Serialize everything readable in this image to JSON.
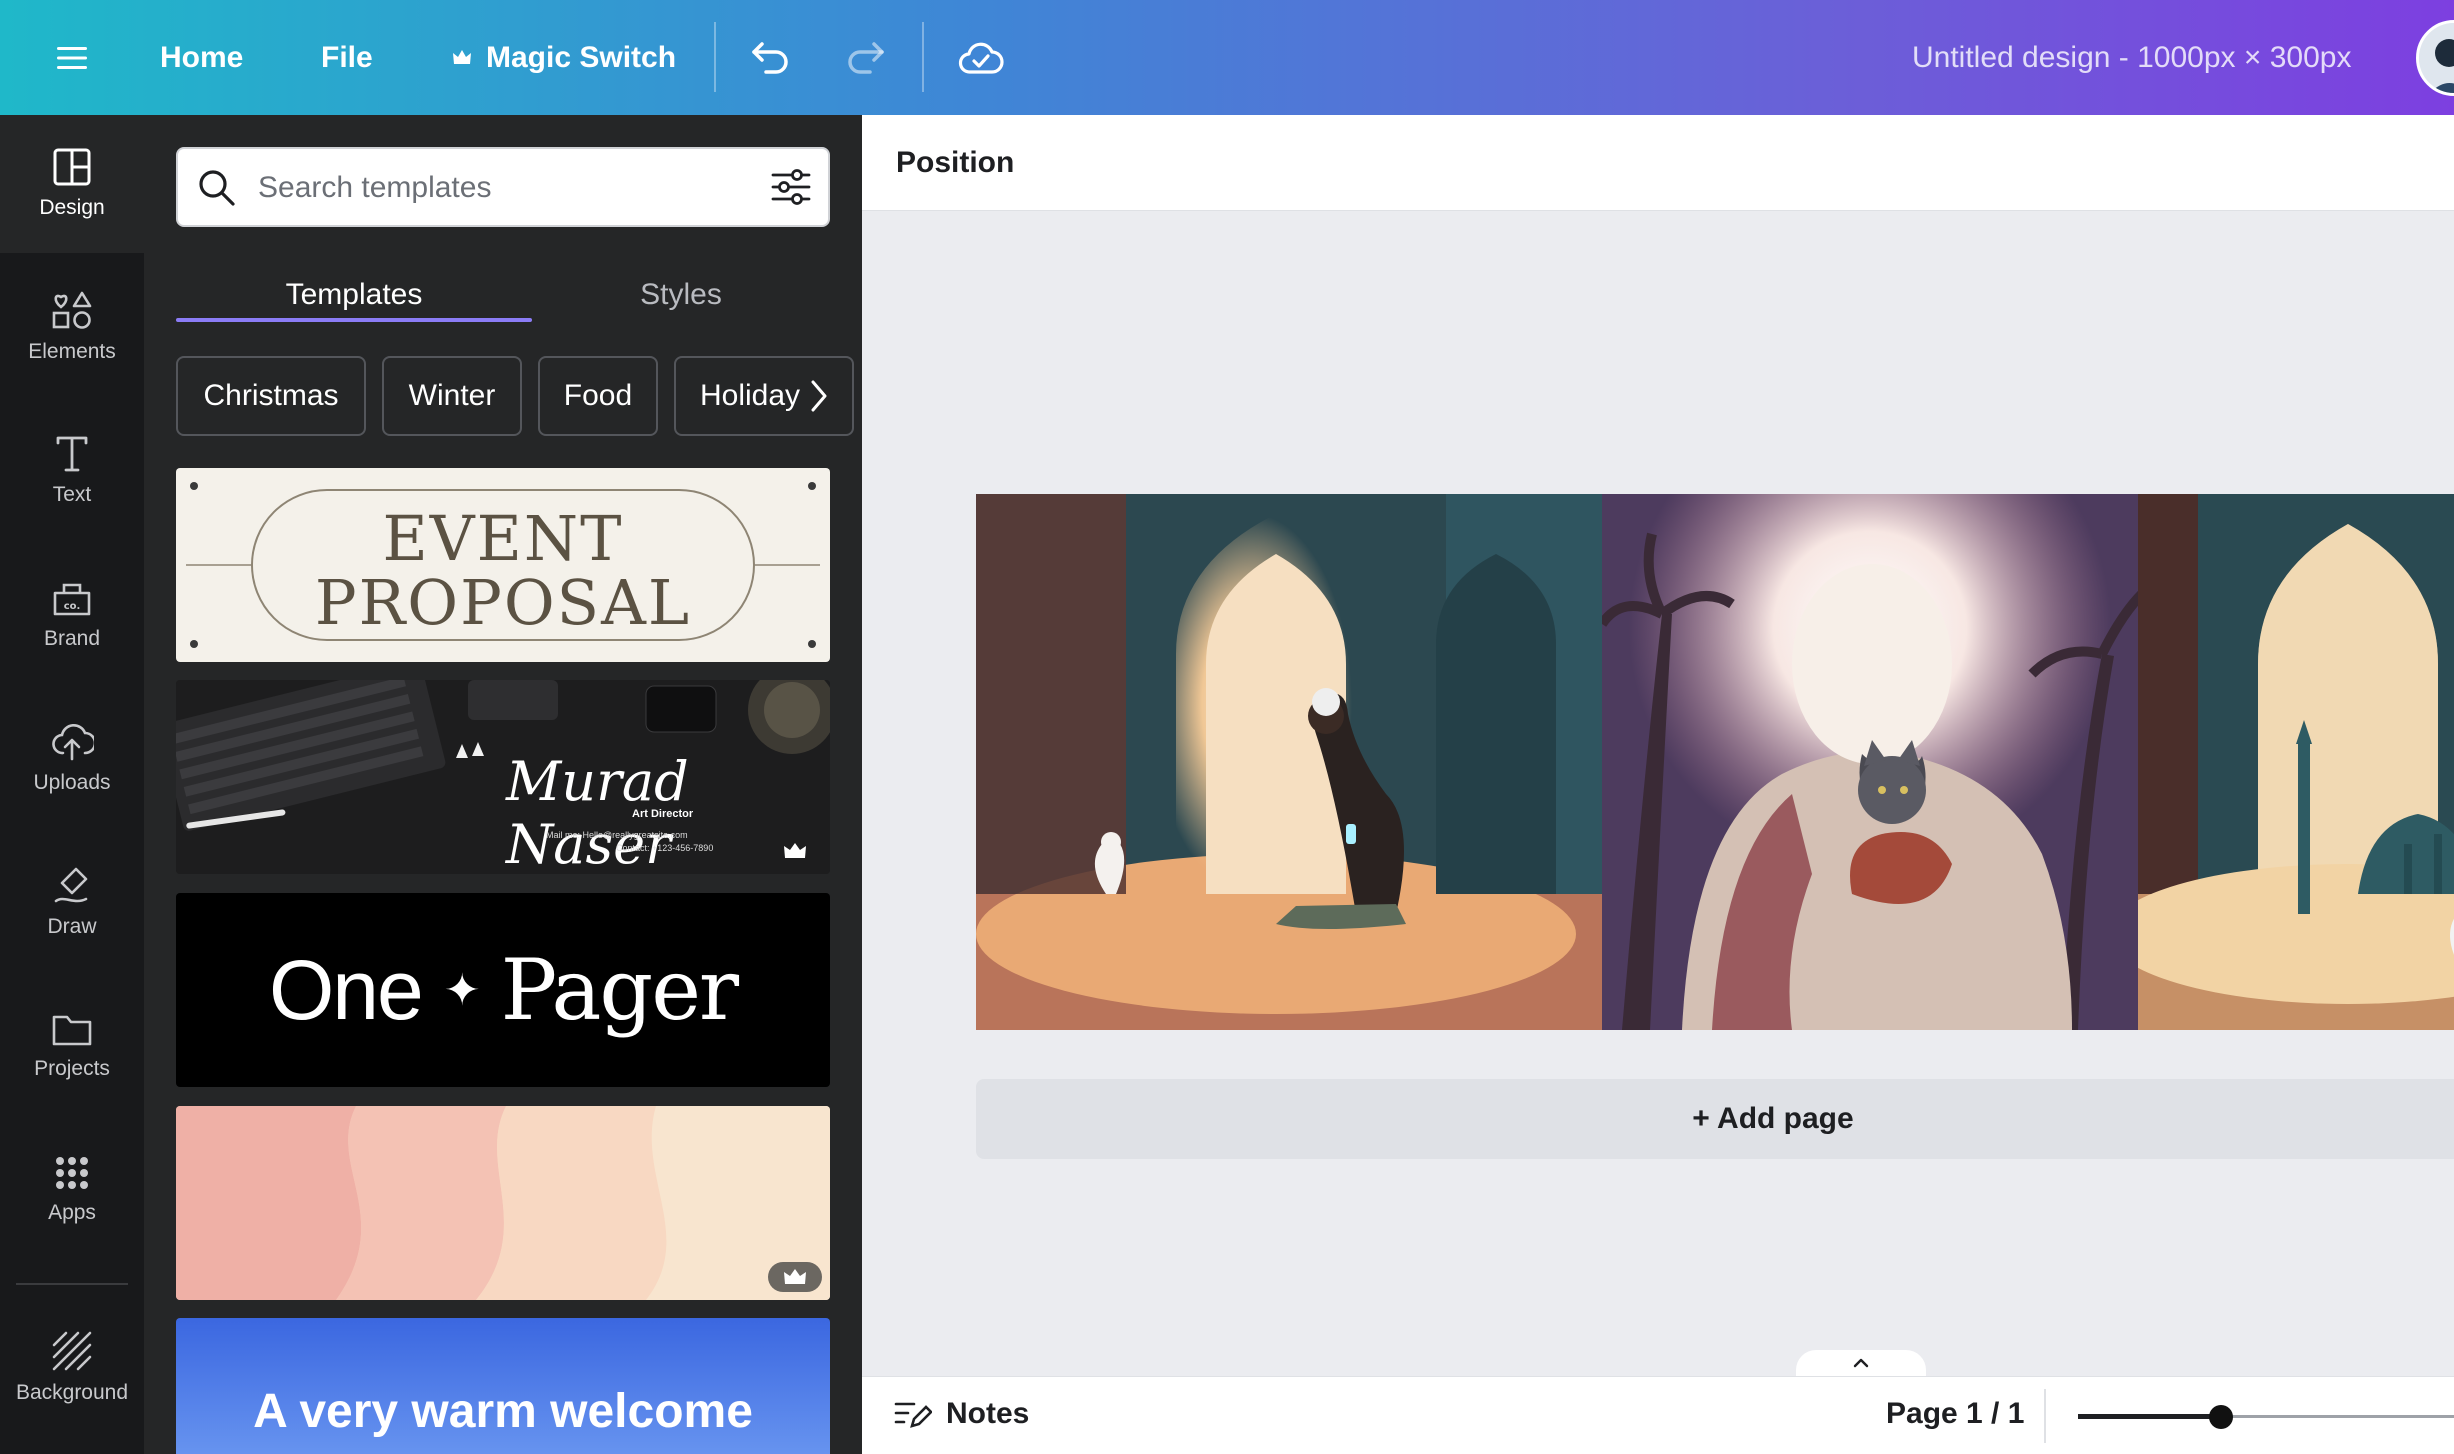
{
  "topbar": {
    "menu_icon": "hamburger-icon",
    "home": "Home",
    "file": "File",
    "magic_switch": "Magic Switch",
    "magic_icon": "crown-icon",
    "undo_icon": "undo-icon",
    "redo_icon": "redo-icon",
    "sync_icon": "cloud-check-icon",
    "doc_title": "Untitled design - 1000px × 300px"
  },
  "rail": {
    "items": [
      {
        "label": "Design",
        "icon": "layout-icon",
        "active": true
      },
      {
        "label": "Elements",
        "icon": "shapes-icon"
      },
      {
        "label": "Text",
        "icon": "text-icon"
      },
      {
        "label": "Brand",
        "icon": "brand-icon"
      },
      {
        "label": "Uploads",
        "icon": "cloud-upload-icon"
      },
      {
        "label": "Draw",
        "icon": "draw-icon"
      },
      {
        "label": "Projects",
        "icon": "folder-icon"
      },
      {
        "label": "Apps",
        "icon": "grid-icon"
      },
      {
        "label": "Background",
        "icon": "hatch-icon"
      }
    ]
  },
  "panel": {
    "search_placeholder": "Search templates",
    "tabs": [
      "Templates",
      "Styles"
    ],
    "active_tab": "Templates",
    "chips": [
      "Christmas",
      "Winter",
      "Food",
      "Holiday"
    ],
    "templates": {
      "event_line1": "EVENT",
      "event_line2": "PROPOSAL",
      "signature_name": "Murad Naser",
      "signature_role": "Art Director",
      "signature_mail": "Mail me: Hello@reallygreatsite.com",
      "signature_contact": "Contact: +123-456-7890",
      "one": "One",
      "star": "✦",
      "pager": "Pager",
      "welcome": "A very warm welcome"
    }
  },
  "main": {
    "position_label": "Position",
    "add_page": "+ Add page",
    "notes": "Notes",
    "page_indicator": "Page 1 / 1",
    "zoom_fraction": 0.38
  },
  "colors": {
    "accent": "#8b7cf6",
    "rail_bg": "#18191b",
    "panel_bg": "#252627"
  }
}
